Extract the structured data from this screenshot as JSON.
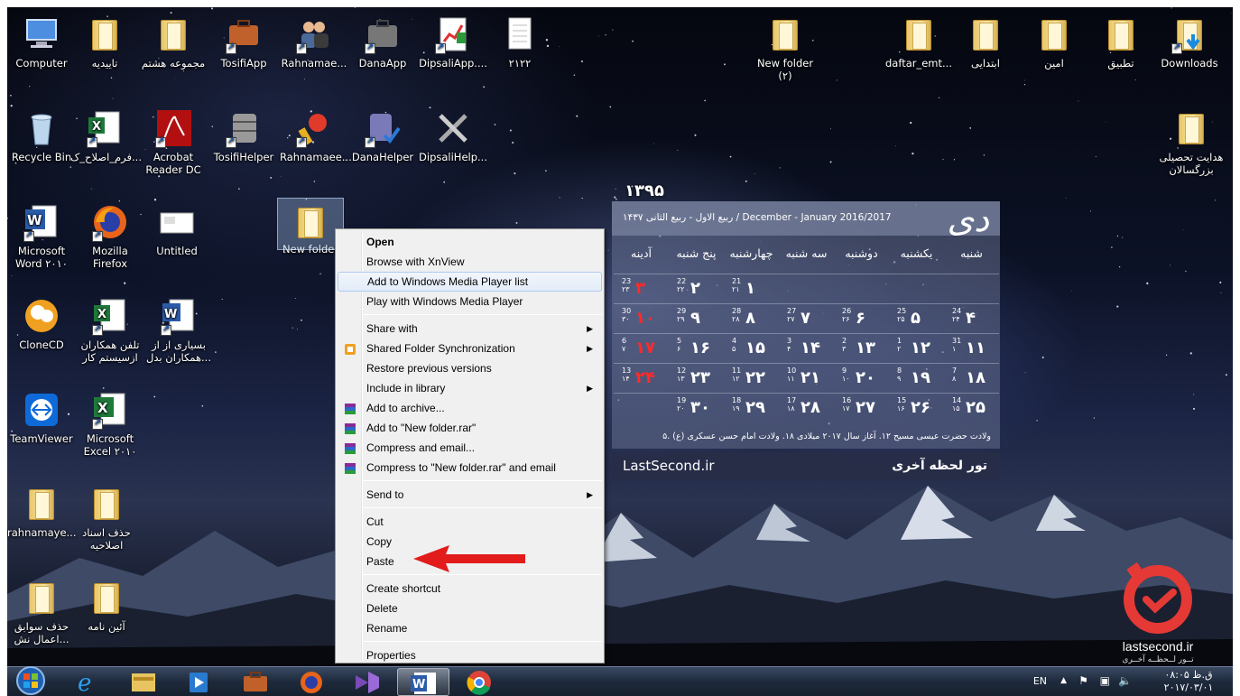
{
  "desktop": {
    "icons": [
      {
        "label": "Computer"
      },
      {
        "label": "تاييديه"
      },
      {
        "label": "مجموعه هشتم"
      },
      {
        "label": "TosifiApp"
      },
      {
        "label": "Rahnamae..."
      },
      {
        "label": "DanaApp"
      },
      {
        "label": "DipsaliApp...."
      },
      {
        "label": "۲۱۲۲"
      },
      {
        "label": "Recycle Bin"
      },
      {
        "label": "فرم_اصلاح_ک..."
      },
      {
        "label": "Acrobat Reader DC"
      },
      {
        "label": "TosifiHelper"
      },
      {
        "label": "Rahnamaee..."
      },
      {
        "label": "DanaHelper"
      },
      {
        "label": "DipsaliHelp..."
      },
      {
        "label": "Microsoft Word ۲۰۱۰"
      },
      {
        "label": "Mozilla Firefox"
      },
      {
        "label": "Untitled"
      },
      {
        "label": "New folder"
      },
      {
        "label": "CloneCD"
      },
      {
        "label": "تلفن همکاران ازسیستم کار"
      },
      {
        "label": "بسیاری از از همکاران بدل..."
      },
      {
        "label": "TeamViewer"
      },
      {
        "label": "Microsoft Excel ۲۰۱۰"
      },
      {
        "label": "rahnamaye..."
      },
      {
        "label": "حذف اسناد اصلاحیه"
      },
      {
        "label": "حذف سوابق اعمال نش..."
      },
      {
        "label": "آئين نامه"
      },
      {
        "label": "New folder (۲)"
      },
      {
        "label": "daftar_emt..."
      },
      {
        "label": "ابتدایی"
      },
      {
        "label": "امین"
      },
      {
        "label": "تطبیق"
      },
      {
        "label": "Downloads"
      },
      {
        "label": "هدایت تحصیلی بزرگسالان"
      }
    ]
  },
  "calendar": {
    "year": "۱۳۹۵",
    "month": "دی",
    "subtitle": "ربیع الاول - ربیع الثانی ۱۴۳۷ / December - January  2016/2017",
    "day_names": [
      "شنبه",
      "یکشنبه",
      "دوشنبه",
      "سه شنبه",
      "چهارشنبه",
      "پنج شنبه",
      "آدینه"
    ],
    "rows": [
      [
        {
          "day": "",
          "g": "",
          "h": ""
        },
        {
          "day": "",
          "g": "",
          "h": ""
        },
        {
          "day": "",
          "g": "",
          "h": ""
        },
        {
          "day": "",
          "g": "",
          "h": ""
        },
        {
          "day": "۱",
          "g": "21",
          "h": "۲۱"
        },
        {
          "day": "۲",
          "g": "22",
          "h": "۲۲"
        },
        {
          "day": "۳",
          "g": "23",
          "h": "۲۳",
          "holiday": true
        }
      ],
      [
        {
          "day": "۴",
          "g": "24",
          "h": "۲۴"
        },
        {
          "day": "۵",
          "g": "25",
          "h": "۲۵"
        },
        {
          "day": "۶",
          "g": "26",
          "h": "۲۶"
        },
        {
          "day": "۷",
          "g": "27",
          "h": "۲۷"
        },
        {
          "day": "۸",
          "g": "28",
          "h": "۲۸"
        },
        {
          "day": "۹",
          "g": "29",
          "h": "۲۹"
        },
        {
          "day": "۱۰",
          "g": "30",
          "h": "۳۰",
          "holiday": true
        }
      ],
      [
        {
          "day": "۱۱",
          "g": "31",
          "h": "۱"
        },
        {
          "day": "۱۲",
          "g": "1",
          "h": "۲"
        },
        {
          "day": "۱۳",
          "g": "2",
          "h": "۳"
        },
        {
          "day": "۱۴",
          "g": "3",
          "h": "۴"
        },
        {
          "day": "۱۵",
          "g": "4",
          "h": "۵"
        },
        {
          "day": "۱۶",
          "g": "5",
          "h": "۶"
        },
        {
          "day": "۱۷",
          "g": "6",
          "h": "۷",
          "holiday": true
        }
      ],
      [
        {
          "day": "۱۸",
          "g": "7",
          "h": "۸"
        },
        {
          "day": "۱۹",
          "g": "8",
          "h": "۹"
        },
        {
          "day": "۲۰",
          "g": "9",
          "h": "۱۰"
        },
        {
          "day": "۲۱",
          "g": "10",
          "h": "۱۱"
        },
        {
          "day": "۲۲",
          "g": "11",
          "h": "۱۲"
        },
        {
          "day": "۲۳",
          "g": "12",
          "h": "۱۳"
        },
        {
          "day": "۲۴",
          "g": "13",
          "h": "۱۴",
          "holiday": true
        }
      ],
      [
        {
          "day": "۲۵",
          "g": "14",
          "h": "۱۵"
        },
        {
          "day": "۲۶",
          "g": "15",
          "h": "۱۶"
        },
        {
          "day": "۲۷",
          "g": "16",
          "h": "۱۷"
        },
        {
          "day": "۲۸",
          "g": "17",
          "h": "۱۸"
        },
        {
          "day": "۲۹",
          "g": "18",
          "h": "۱۹"
        },
        {
          "day": "۳۰",
          "g": "19",
          "h": "۲۰"
        },
        {
          "day": "",
          "g": "",
          "h": ""
        }
      ]
    ],
    "events": "۵. ولادت حضرت عیسی مسیح   ۱۲. آغاز سال ۲۰۱۷ میلادی   ۱۸. ولادت امام حسن عسکری (ع)",
    "site": "LastSecond.ir",
    "tour": "تور لحظه آخری"
  },
  "context_menu": {
    "items": [
      {
        "label": "Open",
        "bold": true
      },
      {
        "label": "Browse with XnView"
      },
      {
        "label": "Add to Windows Media Player list",
        "highlighted": true
      },
      {
        "label": "Play with Windows Media Player"
      },
      {
        "separator": true
      },
      {
        "label": "Share with",
        "submenu": true
      },
      {
        "label": "Shared Folder Synchronization",
        "submenu": true,
        "icon": "sync-icon"
      },
      {
        "label": "Restore previous versions"
      },
      {
        "label": "Include in library",
        "submenu": true
      },
      {
        "label": "Add to archive...",
        "icon": "winrar-icon"
      },
      {
        "label": "Add to \"New folder.rar\"",
        "icon": "winrar-icon"
      },
      {
        "label": "Compress and email...",
        "icon": "winrar-icon"
      },
      {
        "label": "Compress to \"New folder.rar\" and email",
        "icon": "winrar-icon"
      },
      {
        "separator": true
      },
      {
        "label": "Send to",
        "submenu": true
      },
      {
        "separator": true
      },
      {
        "label": "Cut"
      },
      {
        "label": "Copy"
      },
      {
        "label": "Paste"
      },
      {
        "separator": true
      },
      {
        "label": "Create shortcut"
      },
      {
        "label": "Delete"
      },
      {
        "label": "Rename"
      },
      {
        "separator": true
      },
      {
        "label": "Properties"
      }
    ]
  },
  "logo": {
    "name": "lastsecond.ir",
    "tagline": "تــور لــحظــه آخــری",
    "color": "#e53935"
  },
  "taskbar": {
    "apps": [
      "internet-explorer-icon",
      "file-explorer-icon",
      "media-player-icon",
      "briefcase-icon",
      "firefox-icon",
      "visual-studio-icon",
      "word-icon",
      "chrome-icon"
    ],
    "active_app": "word-icon",
    "language": "EN",
    "time": "ق.ظ ۰۸:۰۵",
    "date": "۲۰۱۷/۰۳/۰۱"
  },
  "colors": {
    "accent_red": "#e21b1b",
    "menu_highlight": "#cde3f8"
  }
}
